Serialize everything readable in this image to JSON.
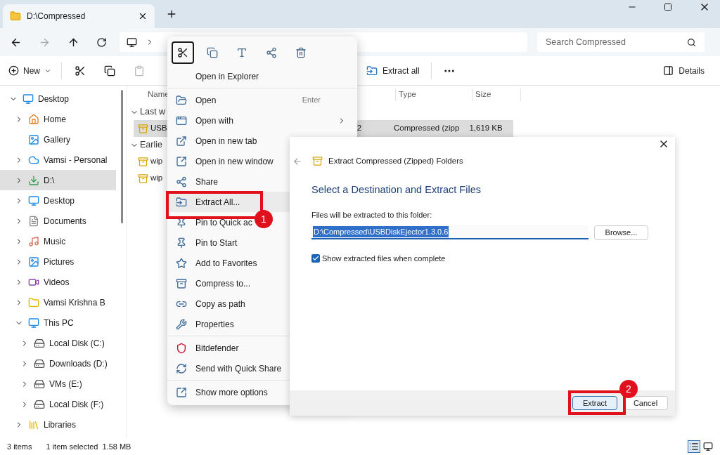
{
  "window": {
    "tab_title": "D:\\Compressed"
  },
  "search": {
    "placeholder": "Search Compressed"
  },
  "toolbar": {
    "new": "New",
    "extract_all": "Extract all",
    "details": "Details"
  },
  "sidebar": {
    "items": [
      {
        "label": "Desktop",
        "expanded": true,
        "has_children": true,
        "selected": false,
        "children": [
          {
            "label": "Home",
            "expanded": false,
            "has_children": true,
            "selected": false
          },
          {
            "label": "Gallery",
            "has_children": false,
            "selected": false
          },
          {
            "label": "Vamsi - Personal",
            "expanded": false,
            "has_children": true,
            "selected": false
          },
          {
            "label": "D:\\",
            "expanded": false,
            "has_children": true,
            "selected": true
          },
          {
            "label": "Desktop",
            "expanded": false,
            "has_children": true,
            "selected": false
          },
          {
            "label": "Documents",
            "expanded": false,
            "has_children": true,
            "selected": false
          },
          {
            "label": "Music",
            "expanded": false,
            "has_children": true,
            "selected": false
          },
          {
            "label": "Pictures",
            "expanded": false,
            "has_children": true,
            "selected": false
          },
          {
            "label": "Videos",
            "expanded": false,
            "has_children": true,
            "selected": false
          },
          {
            "label": "Vamsi Krishna B",
            "expanded": false,
            "has_children": true,
            "selected": false
          },
          {
            "label": "This PC",
            "expanded": true,
            "has_children": true,
            "selected": false,
            "children": [
              {
                "label": "Local Disk (C:)",
                "expanded": false,
                "has_children": true,
                "selected": false
              },
              {
                "label": "Downloads (D:)",
                "expanded": false,
                "has_children": true,
                "selected": false
              },
              {
                "label": "VMs (E:)",
                "expanded": false,
                "has_children": true,
                "selected": false
              },
              {
                "label": "Local Disk (F:)",
                "expanded": false,
                "has_children": true,
                "selected": false
              }
            ]
          },
          {
            "label": "Libraries",
            "expanded": false,
            "has_children": true,
            "selected": false
          }
        ]
      }
    ]
  },
  "files": {
    "columns": [
      "Name",
      "Type",
      "Size"
    ],
    "groups": [
      {
        "label": "Last w",
        "expanded": true,
        "rows": [
          {
            "name": "USB",
            "column_2": "2",
            "type": "Compressed (zipp",
            "size": "1,619 KB",
            "selected": true
          }
        ]
      },
      {
        "label": "Earlie",
        "expanded": true,
        "rows": [
          {
            "name": "wip",
            "selected": false
          },
          {
            "name": "wip",
            "selected": false
          }
        ]
      }
    ]
  },
  "status_bar": {
    "count": "3 items",
    "selection": "1 item selected",
    "size": "1.58 MB"
  },
  "context_menu": {
    "quick_actions": [
      {
        "selected": true
      },
      {
        "selected": false
      },
      {
        "selected": false
      },
      {
        "selected": false
      },
      {
        "selected": false
      }
    ],
    "sections": [
      [
        {
          "label": "Open in Explorer",
          "selected": false
        }
      ],
      [
        {
          "label": "Open",
          "shortcut": "Enter",
          "selected": false
        },
        {
          "label": "Open with",
          "submenu": true,
          "selected": false
        },
        {
          "label": "Open in new tab",
          "selected": false
        },
        {
          "label": "Open in new window",
          "selected": false
        },
        {
          "label": "Share",
          "selected": false
        },
        {
          "label": "Extract All...",
          "selected": true
        },
        {
          "label": "Pin to Quick ac",
          "selected": false
        },
        {
          "label": "Pin to Start",
          "selected": false
        },
        {
          "label": "Add to Favorites",
          "selected": false
        },
        {
          "label": "Compress to...",
          "selected": false
        },
        {
          "label": "Copy as path",
          "selected": false
        },
        {
          "label": "Properties",
          "selected": false
        }
      ],
      [
        {
          "label": "Bitdefender",
          "selected": false
        },
        {
          "label": "Send with Quick Share",
          "selected": false
        }
      ],
      [
        {
          "label": "Show more options",
          "selected": false
        }
      ]
    ]
  },
  "dialog": {
    "title": "Extract Compressed (Zipped) Folders",
    "heading": "Select a Destination and Extract Files",
    "path_label": "Files will be extracted to this folder:",
    "path_value": "D:\\Compressed\\USBDiskEjector1.3.0.6",
    "browse": "Browse...",
    "show_files": {
      "label": "Show extracted files when complete",
      "checked": true
    },
    "buttons": [
      {
        "label": "Extract",
        "default": true
      },
      {
        "label": "Cancel",
        "default": false
      }
    ]
  },
  "annotations": [
    {
      "label": "1"
    },
    {
      "label": "2"
    }
  ]
}
